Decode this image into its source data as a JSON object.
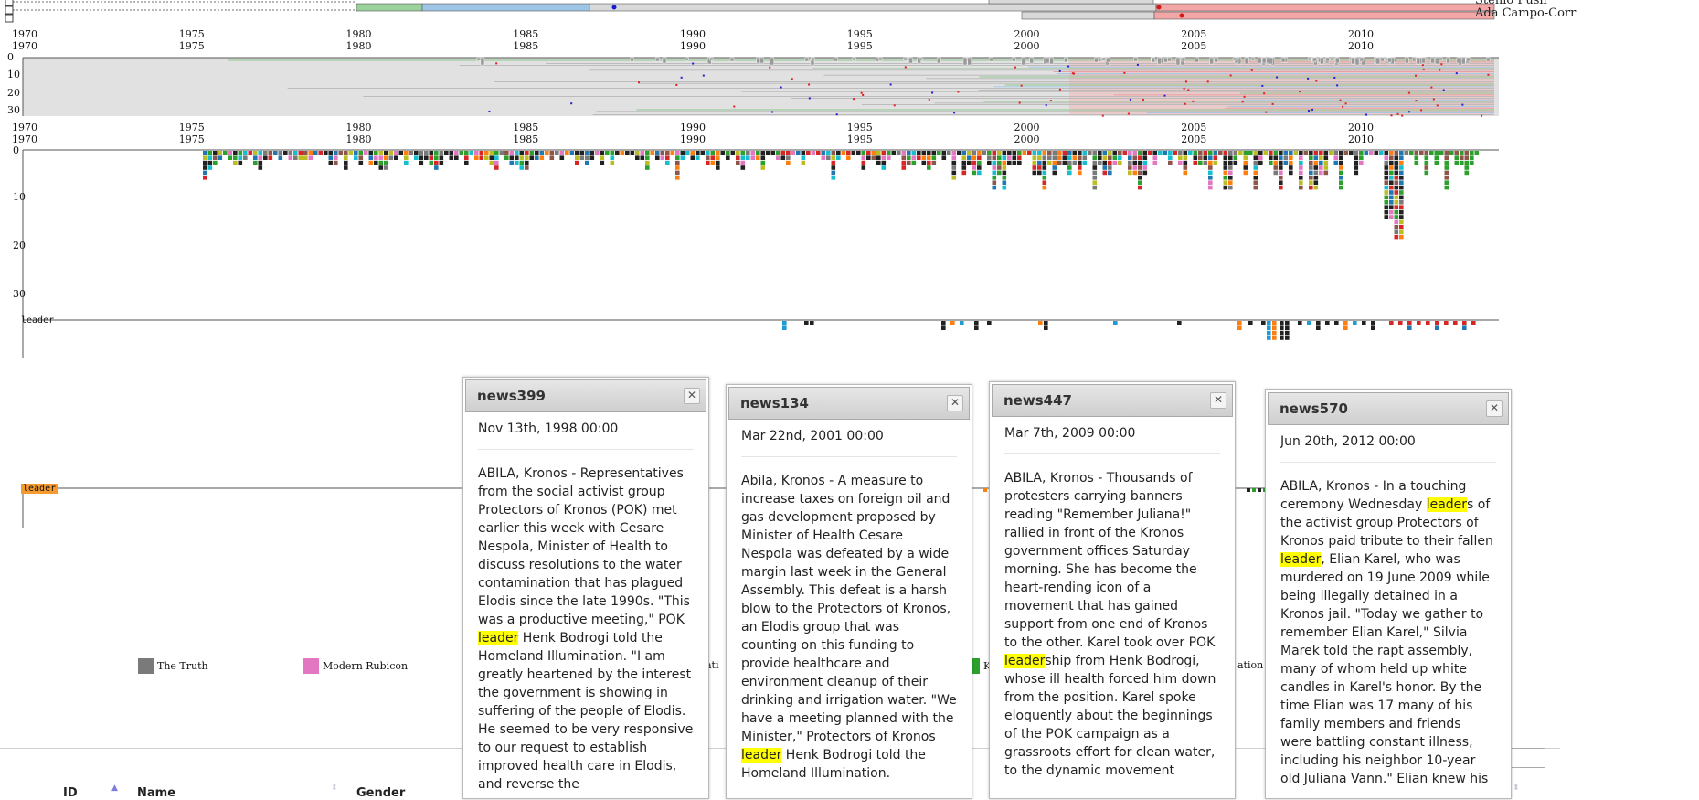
{
  "timeline": {
    "years": [
      "1970",
      "1975",
      "1980",
      "1985",
      "1990",
      "1995",
      "2000",
      "2005",
      "2010"
    ],
    "detail_ticks": [
      "0",
      "10",
      "20",
      "30"
    ],
    "keyword_label": "leader",
    "people": [
      "Stenio Fusil",
      "Ada Campo-Corr"
    ]
  },
  "legend": {
    "items": [
      {
        "label": "The Truth",
        "color": "#7a7a7a"
      },
      {
        "label": "Modern Rubicon",
        "color": "#e377c2"
      }
    ],
    "partial_labels": [
      "ati",
      "K",
      "ation"
    ],
    "partial_colors": [
      "#2ca02c"
    ]
  },
  "popups": [
    {
      "title": "news399",
      "date": "Nov 13th, 1998 00:00",
      "parts": [
        {
          "t": "ABILA, Kronos - Representatives from the social activist group Protectors of Kronos (POK) met earlier this week with Cesare Nespola, Minister of Health to discuss resolutions to the water contamination that has plagued Elodis since the late 1990s. \"This was a productive meeting,\" POK "
        },
        {
          "t": "leader",
          "hl": true
        },
        {
          "t": " Henk Bodrogi told the Homeland Illumination. \"I am greatly heartened by the interest the government is showing in suffering of the people of Elodis. He seemed to be very responsive to our request to establish improved health care in Elodis, and reverse the"
        }
      ]
    },
    {
      "title": "news134",
      "date": "Mar 22nd, 2001 00:00",
      "parts": [
        {
          "t": "Abila, Kronos - A measure to increase taxes on foreign oil and gas development proposed by Minister of Health Cesare Nespola was defeated by a wide margin last week in the General Assembly. This defeat is a harsh blow to the Protectors of Kronos, an Elodis group that was counting on this funding to provide healthcare and environment cleanup of their drinking and irrigation water. \"We have a meeting planned with the Minister,\" Protectors of Kronos "
        },
        {
          "t": "leader",
          "hl": true
        },
        {
          "t": " Henk Bodrogi told the Homeland Illumination."
        }
      ]
    },
    {
      "title": "news447",
      "date": "Mar 7th, 2009 00:00",
      "parts": [
        {
          "t": "ABILA, Kronos - Thousands of protesters carrying banners reading \"Remember Juliana!\" rallied in front of the Kronos government offices Saturday morning. She has become the heart-rending icon of a movement that has gained support from one end of Kronos to the other. Karel took over POK "
        },
        {
          "t": "leader",
          "hl": true
        },
        {
          "t": "ship from Henk Bodrogi, whose ill health forced him down from the position. Karel spoke eloquently about the beginnings of the POK campaign as a grassroots effort for clean water, to the dynamic movement"
        }
      ]
    },
    {
      "title": "news570",
      "date": "Jun 20th, 2012 00:00",
      "parts": [
        {
          "t": "ABILA, Kronos - In a touching ceremony Wednesday "
        },
        {
          "t": "leader",
          "hl": true
        },
        {
          "t": "s of the activist group Protectors of Kronos paid tribute to their fallen "
        },
        {
          "t": "leader",
          "hl": true
        },
        {
          "t": ", Elian Karel, who was murdered on 19 June 2009 while being illegally detained in a Kronos jail. \"Today we gather to remember Elian Karel,\" Silvia Marek told the rapt assembly, many of whom held up white candles in Karel's honor. By the time Elian was 17 many of his family members and friends were battling constant illness, including his neighbor 10-year old Juliana Vann.\" Elian knew his"
        }
      ]
    }
  ],
  "table": {
    "columns": [
      "ID",
      "Name",
      "Gender"
    ]
  }
}
